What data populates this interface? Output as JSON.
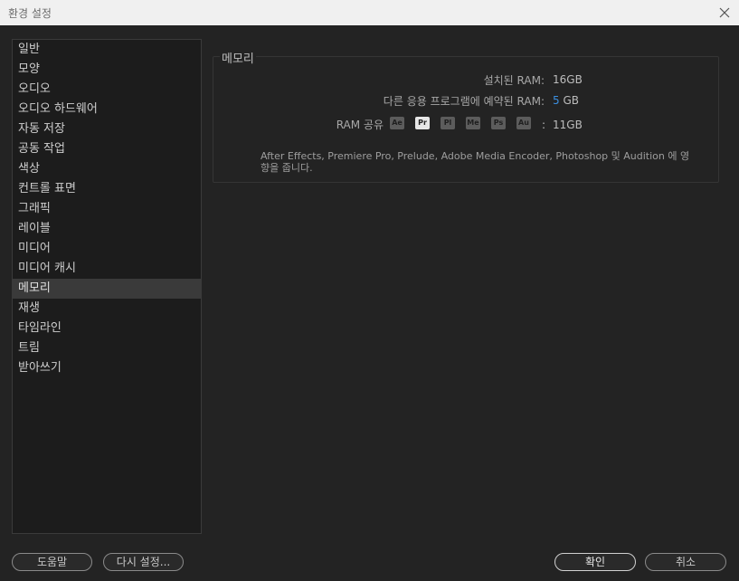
{
  "window": {
    "title": "환경 설정"
  },
  "sidebar": {
    "items": [
      {
        "label": "일반"
      },
      {
        "label": "모양"
      },
      {
        "label": "오디오"
      },
      {
        "label": "오디오 하드웨어"
      },
      {
        "label": "자동 저장"
      },
      {
        "label": "공동 작업"
      },
      {
        "label": "색상"
      },
      {
        "label": "컨트롤 표면"
      },
      {
        "label": "그래픽"
      },
      {
        "label": "레이블"
      },
      {
        "label": "미디어"
      },
      {
        "label": "미디어 캐시"
      },
      {
        "label": "메모리"
      },
      {
        "label": "재생"
      },
      {
        "label": "타임라인"
      },
      {
        "label": "트림"
      },
      {
        "label": "받아쓰기"
      }
    ],
    "selected_index": 12
  },
  "memory": {
    "title": "메모리",
    "installed_label": "설치된 RAM:",
    "installed_value": "16GB",
    "reserved_label": "다른 응용 프로그램에 예약된 RAM:",
    "reserved_value": "5",
    "reserved_unit": "GB",
    "shared_label": "RAM 공유",
    "apps": [
      "Ae",
      "Pr",
      "Pl",
      "Me",
      "Ps",
      "Au"
    ],
    "active_app": "Pr",
    "shared_colon": ":",
    "shared_value": "11GB",
    "note": "After Effects, Premiere Pro, Prelude, Adobe Media Encoder, Photoshop 및 Audition 에 영향을 줍니다."
  },
  "buttons": {
    "help": "도움말",
    "reset": "다시 설정...",
    "ok": "확인",
    "cancel": "취소"
  },
  "colors": {
    "accent_value": "#3b8fe0",
    "background": "#232323"
  }
}
